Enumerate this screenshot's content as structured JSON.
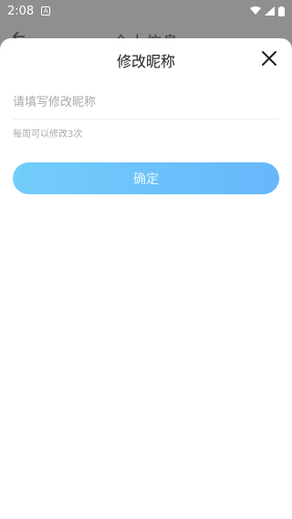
{
  "status_bar": {
    "time": "2:08",
    "notification_icon": "a-icon",
    "icons": [
      "wifi-icon",
      "signal-icon",
      "battery-icon"
    ]
  },
  "background_page": {
    "back_icon": "back-arrow-icon",
    "title": "个人信息"
  },
  "sheet": {
    "title": "修改昵称",
    "close_icon": "close-icon",
    "input": {
      "placeholder": "请填写修改昵称",
      "value": ""
    },
    "hint": "每周可以修改3次",
    "confirm_label": "确定"
  },
  "colors": {
    "button_gradient_start": "#73cdfb",
    "button_gradient_end": "#66b7fb",
    "overlay": "#8f8f8f"
  }
}
